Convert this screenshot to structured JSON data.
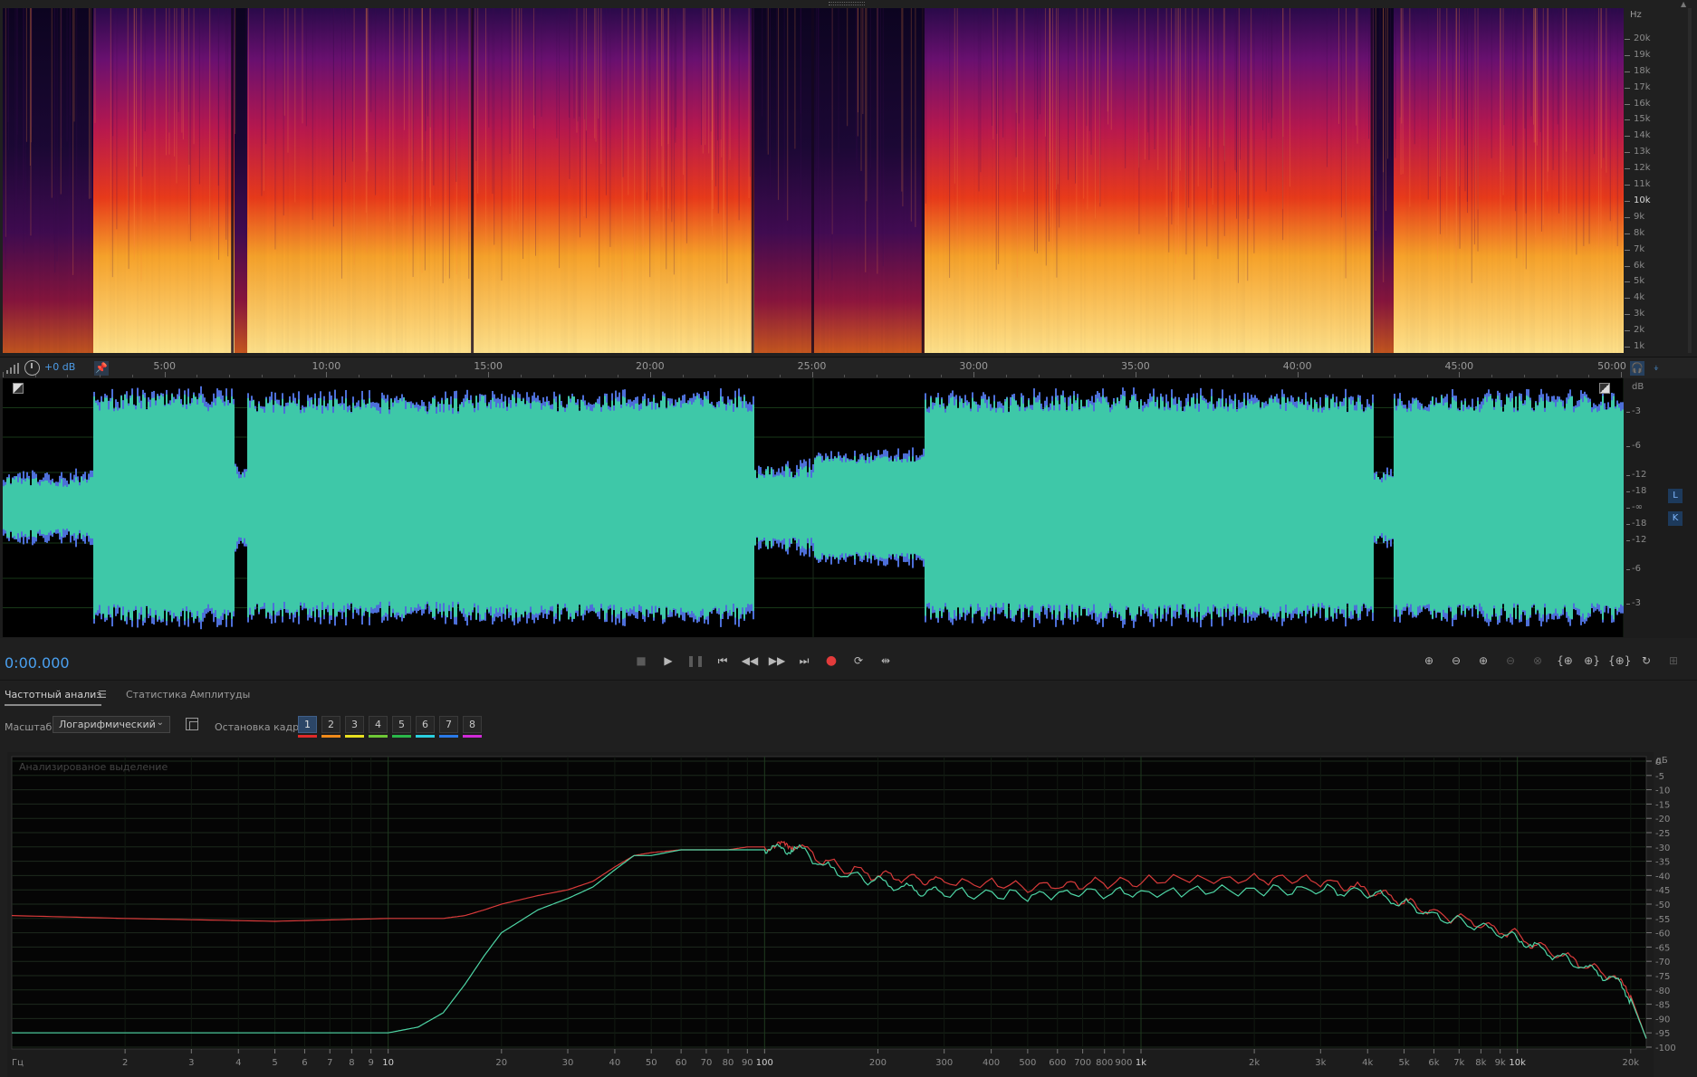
{
  "spectral": {
    "unit": "Hz",
    "freq_labels": [
      "20k",
      "19k",
      "18k",
      "17k",
      "16k",
      "15k",
      "14k",
      "13k",
      "12k",
      "11k",
      "10k",
      "9k",
      "8k",
      "7k",
      "6k",
      "5k",
      "4k",
      "3k",
      "2k",
      "1k"
    ],
    "bright_label": "10k"
  },
  "ruler": {
    "gain": "+0 dB",
    "time_labels": [
      "5:00",
      "10:00",
      "15:00",
      "20:00",
      "25:00",
      "30:00",
      "35:00",
      "40:00",
      "45:00",
      "50:00"
    ]
  },
  "waveform": {
    "db_unit": "dB",
    "db_labels": [
      "-3",
      "-6",
      "-12",
      "-18",
      "-∞",
      "-18",
      "-12",
      "-6",
      "-3"
    ],
    "channel_left": "L",
    "channel_right": "K",
    "colors": {
      "wave": "#3ec8a8",
      "peaks": "#4d6fd8"
    }
  },
  "transport": {
    "time": "0:00.000",
    "buttons": [
      "stop-icon",
      "play-icon",
      "pause-icon",
      "move-to-start-icon",
      "rewind-icon",
      "fast-forward-icon",
      "move-to-end-icon",
      "record-icon",
      "loop-icon",
      "skip-selection-icon"
    ]
  },
  "analysis": {
    "tabs": [
      "Частотный анализ",
      "Статистика Амплитуды"
    ],
    "scale_label": "Масштаб:",
    "scale_value": "Логарифмический",
    "hold_label": "Остановка кадра:",
    "hold_buttons": [
      "1",
      "2",
      "3",
      "4",
      "5",
      "6",
      "7",
      "8"
    ],
    "hold_colors": [
      "#e02a2a",
      "#f08a1a",
      "#e8e020",
      "#6ec836",
      "#2ab84a",
      "#2ad0e0",
      "#2a7ae8",
      "#d02ad8"
    ],
    "chart_title": "Анализированое выделение"
  },
  "chart_data": {
    "type": "line",
    "title": "Анализированое выделение",
    "xlabel": "Гц",
    "ylabel": "дБ",
    "x_scale": "log",
    "x_ticks": [
      "2",
      "3",
      "4",
      "5",
      "6",
      "7",
      "8",
      "9",
      "10",
      "20",
      "30",
      "40",
      "50",
      "60",
      "70",
      "80",
      "90",
      "100",
      "200",
      "300",
      "400",
      "500",
      "600",
      "700",
      "800",
      "900",
      "1k",
      "2k",
      "3k",
      "4k",
      "5k",
      "6k",
      "7k",
      "8k",
      "9k",
      "10k",
      "20k"
    ],
    "y_ticks": [
      "0",
      "-5",
      "-10",
      "-15",
      "-20",
      "-25",
      "-30",
      "-35",
      "-40",
      "-45",
      "-50",
      "-55",
      "-60",
      "-65",
      "-70",
      "-75",
      "-80",
      "-85",
      "-90",
      "-95",
      "-100"
    ],
    "ylim": [
      -100,
      0
    ],
    "x": [
      1,
      2,
      5,
      10,
      12,
      14,
      16,
      18,
      20,
      25,
      30,
      35,
      40,
      45,
      50,
      60,
      70,
      80,
      90,
      100,
      110,
      120,
      150,
      200,
      250,
      300,
      500,
      700,
      1000,
      2000,
      3000,
      4000,
      5000,
      6000,
      8000,
      10000,
      12000,
      15000,
      18000,
      20000,
      22000
    ],
    "series": [
      {
        "color": "#d83a3a",
        "values": [
          -54,
          -55,
          -56,
          -55,
          -55,
          -55,
          -54,
          -52,
          -50,
          -47,
          -45,
          -42,
          -37,
          -33,
          -32,
          -31,
          -31,
          -31,
          -30,
          -30,
          -30,
          -29,
          -36,
          -40,
          -41,
          -42,
          -44,
          -43,
          -42,
          -41,
          -42,
          -45,
          -49,
          -53,
          -57,
          -61,
          -66,
          -71,
          -75,
          -82,
          -97
        ]
      },
      {
        "color": "#4ed6a6",
        "values": [
          -95,
          -95,
          -95,
          -95,
          -93,
          -88,
          -78,
          -68,
          -60,
          -52,
          -48,
          -44,
          -38,
          -33,
          -33,
          -31,
          -31,
          -31,
          -31,
          -31,
          -31,
          -30,
          -38,
          -42,
          -45,
          -46,
          -47,
          -46,
          -46,
          -45,
          -45,
          -46,
          -50,
          -54,
          -58,
          -62,
          -67,
          -72,
          -76,
          -83,
          -97
        ]
      }
    ]
  }
}
